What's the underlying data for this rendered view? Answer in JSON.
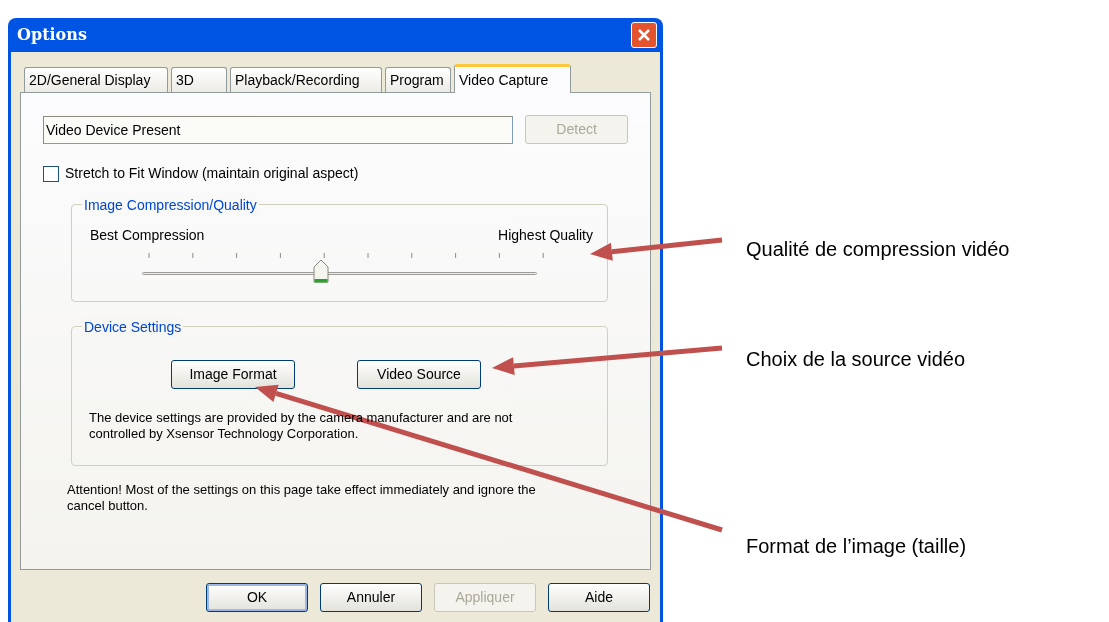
{
  "window": {
    "title": "Options"
  },
  "tabs": [
    {
      "label": "2D/General Display",
      "selected": false
    },
    {
      "label": "3D",
      "selected": false
    },
    {
      "label": "Playback/Recording",
      "selected": false
    },
    {
      "label": "Program",
      "selected": false
    },
    {
      "label": "Video Capture",
      "selected": true
    }
  ],
  "device_status": {
    "value": "Video Device Present"
  },
  "detect_button": {
    "label": "Detect",
    "disabled": true
  },
  "stretch_checkbox": {
    "label": "Stretch to Fit Window (maintain original aspect)",
    "checked": false
  },
  "quality_group": {
    "title": "Image Compression/Quality",
    "min_label": "Best Compression",
    "max_label": "Highest Quality",
    "slider": {
      "level": 0.444
    }
  },
  "device_group": {
    "title": "Device Settings",
    "buttons": [
      "Image Format",
      "Video Source"
    ],
    "note": "The device settings are provided by the camera manufacturer and are not controlled by Xsensor Technology Corporation."
  },
  "warning": "Attention!  Most of the settings on this page take effect immediately and ignore the cancel button.",
  "buttons": [
    {
      "label": "OK",
      "default": true,
      "disabled": false
    },
    {
      "label": "Annuler",
      "default": false,
      "disabled": false
    },
    {
      "label": "Appliquer",
      "default": false,
      "disabled": true
    },
    {
      "label": "Aide",
      "default": false,
      "disabled": false
    }
  ],
  "annotations": [
    {
      "text": "Qualité de compression  vidéo"
    },
    {
      "text": "Choix de la source vidéo"
    },
    {
      "text": "Format de l’image (taille)"
    }
  ]
}
